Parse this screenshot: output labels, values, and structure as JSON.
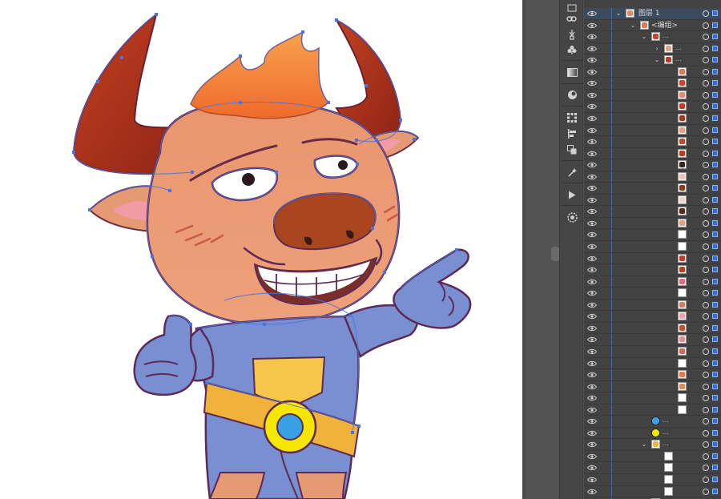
{
  "layers_panel": {
    "top_layer": {
      "name": "图层 1"
    },
    "group": {
      "name": "<编组>"
    },
    "ellipsis": "...",
    "thumb_colors": [
      "#d97a5a",
      "#c9452b",
      "#e48a6a",
      "#c43a20",
      "#a0381d",
      "#e8a085",
      "#c04a2a",
      "#b6401e",
      "#3a2518",
      "#f1c0b0",
      "#8a3a1a",
      "#f3d4c8",
      "#5a2a18",
      "#e4a07a",
      "#ffffff",
      "#ffffff",
      "#cc3b2a",
      "#b84018",
      "#e46a7a",
      "#ffffff",
      "#d68060",
      "#f4a0b0",
      "#c05030",
      "#e0908a",
      "#d66a50",
      "#ffffff",
      "#e57a4a",
      "#e08a5a",
      "#ffffff",
      "#ffffff"
    ],
    "circle_blue": "#3aa0e6",
    "circle_yellow": "#f7e600"
  },
  "colors": {
    "accent_blue": "#2f70d8",
    "panel_bg": "#424242",
    "outline": "#5b2b55",
    "path": "#4a72e0"
  }
}
